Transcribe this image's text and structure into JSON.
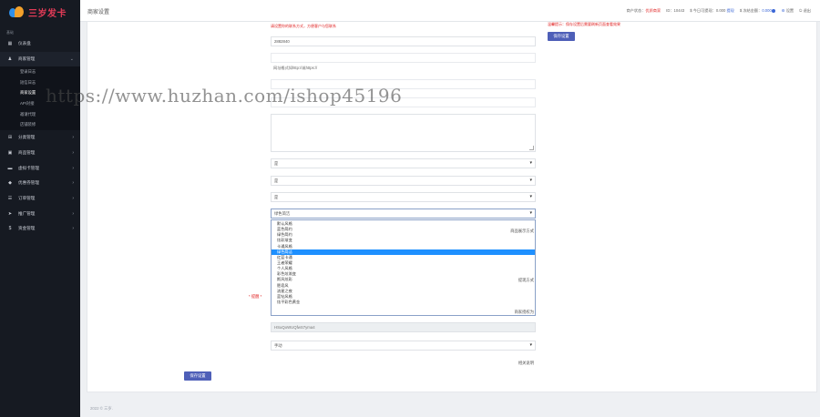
{
  "app": {
    "logo_text": "三岁发卡"
  },
  "sidebar": {
    "section_title": "基础",
    "items": [
      {
        "label": "仪表盘",
        "icon": "dashboard-icon",
        "glyph": "▦",
        "has_children": false
      },
      {
        "label": "商家管理",
        "icon": "user-icon",
        "glyph": "♟",
        "has_children": true,
        "open": true,
        "children": [
          "登录日志",
          "短信日志",
          "商家设置",
          "API对接",
          "邀请代理",
          "店铺装修"
        ],
        "active_child": 2
      },
      {
        "label": "分类管理",
        "icon": "grid-icon",
        "glyph": "⊞",
        "has_children": true
      },
      {
        "label": "商品管理",
        "icon": "box-icon",
        "glyph": "▣",
        "has_children": true
      },
      {
        "label": "虚拟卡管理",
        "icon": "card-icon",
        "glyph": "▬",
        "has_children": true
      },
      {
        "label": "优惠券管理",
        "icon": "tag-icon",
        "glyph": "◆",
        "has_children": true
      },
      {
        "label": "订单管理",
        "icon": "list-icon",
        "glyph": "☰",
        "has_children": true
      },
      {
        "label": "推广管理",
        "icon": "send-icon",
        "glyph": "➤",
        "has_children": true
      },
      {
        "label": "资金管理",
        "icon": "money-icon",
        "glyph": "$",
        "has_children": true
      }
    ]
  },
  "topbar": {
    "title": "商家设置",
    "merchant_status_label": "商户状态：",
    "merchant_status": "优质商家",
    "id_label": "ID：",
    "id_value": "10443",
    "withdraw_label": "$ 今日可提现：",
    "withdraw_value": "0.000",
    "withdraw_link": "提现",
    "balance_label": "$ 冻结金额：",
    "balance_value": "0.000",
    "settings_label": "设置",
    "logout_label": "退出"
  },
  "form": {
    "top_hint": "请设置你的联系方式，方便客户与您联系",
    "qq": {
      "label": "商户QQ",
      "value": "2882840"
    },
    "website": {
      "label": "商户网址",
      "value": ""
    },
    "website_hint": "网址格式如http://或https://",
    "contact": {
      "label": "手机号",
      "value": ""
    },
    "wechat": {
      "label": "微信号",
      "value": ""
    },
    "notice": {
      "label": "店铺公告",
      "value": ""
    },
    "sel1": {
      "label": "购买页面自动弹窗",
      "value": "是"
    },
    "sel2": {
      "label": "商家公告自动弹出",
      "value": "是"
    },
    "sel3": {
      "label": "购卡页面自动弹窗",
      "value": "是"
    },
    "template": {
      "label": "支付页面模板",
      "value": "绿色简洁"
    },
    "template_options": [
      "默认风格",
      "蓝色简约",
      "绿色简约",
      "炫彩渐变",
      "卡通风格",
      "绿色简洁",
      "红蓝卡通",
      "王者荣耀",
      "个人风格",
      "彩色炫渐变",
      "斯风炫彩",
      "肥皂风",
      "流星之夜",
      "蓝钻风格",
      "炫平彩色黄金"
    ],
    "template_selected": 5,
    "display_label": "商品展示方式",
    "pay_method_label": "提现方式",
    "required_note": "* 提醒 *",
    "auth_label": "商家授权为",
    "agent_code": {
      "label": "代理商授权密钥",
      "value": "HSuQoWUQfwS7yma4"
    },
    "agent_mode": {
      "label": "代理审核方式",
      "value": "手动"
    },
    "related_label": "相关说明",
    "save_button": "保存设置"
  },
  "right": {
    "hint": "温馨提示：保存设置后需要刷新页面查看效果",
    "save_button": "保存设置"
  },
  "footer": {
    "copyright": "2022 © 三岁."
  },
  "watermark": {
    "text": "https://www.huzhan.com/ishop45196"
  },
  "colors": {
    "sidebar_bg": "#161a22",
    "accent": "#4e5fb8",
    "danger": "#e02424",
    "select_highlight": "#1e90ff"
  }
}
